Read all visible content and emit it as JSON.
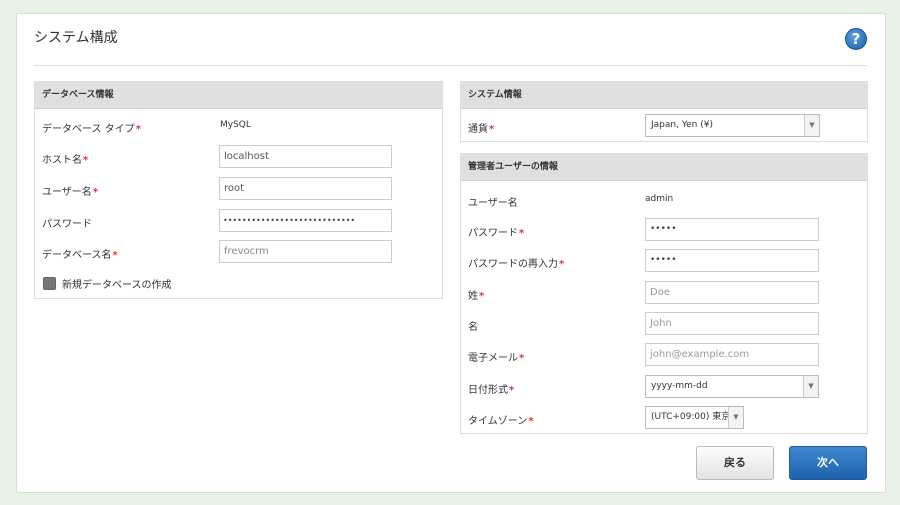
{
  "page": {
    "title": "システム構成",
    "help_icon": "question-icon"
  },
  "database": {
    "heading": "データベース情報",
    "type_label": "データベース タイプ",
    "type_value": "MySQL",
    "host_label": "ホスト名",
    "host_value": "localhost",
    "user_label": "ユーザー名",
    "user_value": "root",
    "password_label": "パスワード",
    "password_value": "••••••••••••••••••••••••••••",
    "dbname_label": "データベース名",
    "dbname_value": "frevocrm",
    "create_label": "新規データベースの作成"
  },
  "system": {
    "heading": "システム情報",
    "currency_label": "通貨",
    "currency_value": "Japan, Yen (¥)"
  },
  "admin": {
    "heading": "管理者ユーザーの情報",
    "user_label": "ユーザー名",
    "user_value": "admin",
    "password_label": "パスワード",
    "password_value": "•••••",
    "password2_label": "パスワードの再入力",
    "password2_value": "•••••",
    "lastname_label": "姓",
    "lastname_placeholder": "Doe",
    "firstname_label": "名",
    "firstname_placeholder": "John",
    "email_label": "電子メール",
    "email_placeholder": "john@example.com",
    "dateformat_label": "日付形式",
    "dateformat_value": "yyyy-mm-dd",
    "timezone_label": "タイムゾーン",
    "timezone_value": "(UTC+09:00) 東京"
  },
  "buttons": {
    "back": "戻る",
    "next": "次へ"
  },
  "required_mark": "*",
  "colors": {
    "accent": "#1e62ad",
    "required": "#dd3333",
    "background": "#e9f2e6"
  }
}
